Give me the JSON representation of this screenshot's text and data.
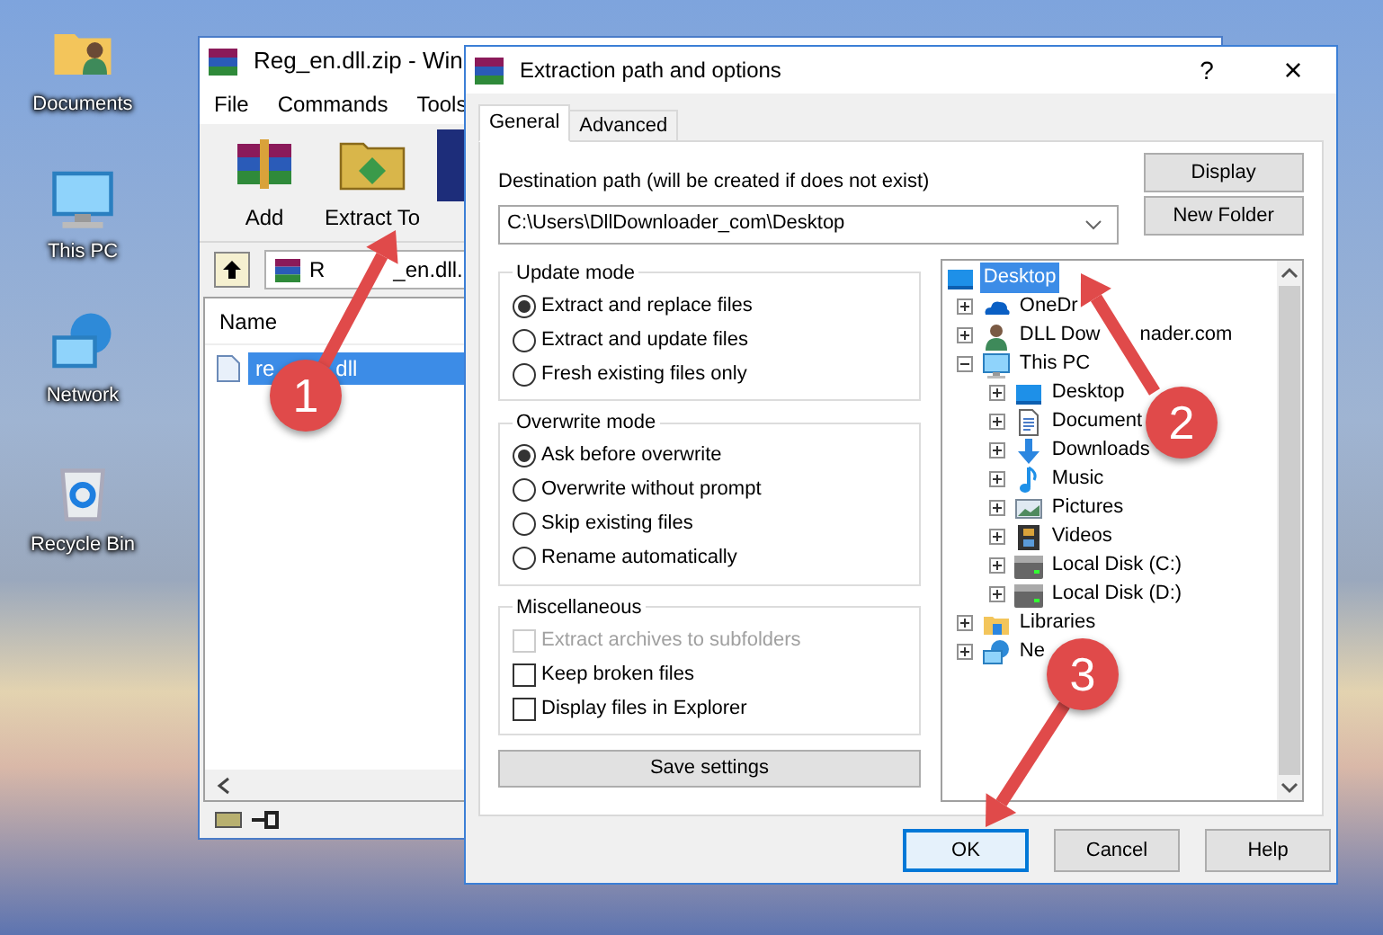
{
  "desktop_icons": [
    {
      "kind": "documents",
      "label": "Documents"
    },
    {
      "kind": "computer",
      "label": "This PC"
    },
    {
      "kind": "network",
      "label": "Network"
    },
    {
      "kind": "recycle",
      "label": "Recycle Bin"
    }
  ],
  "archiver": {
    "title": "Reg_en.dll.zip - Win",
    "menu": [
      "File",
      "Commands",
      "Tools"
    ],
    "toolbar": [
      {
        "kind": "add",
        "label": "Add"
      },
      {
        "kind": "extract",
        "label": "Extract To"
      }
    ],
    "address": {
      "text": "R",
      "text_after": "_en.dll."
    },
    "columns": [
      "Name"
    ],
    "files": [
      {
        "name": "re",
        "name_after": "dll",
        "selected": true
      }
    ]
  },
  "dialog": {
    "title": "Extraction path and options",
    "help": "?",
    "close": "×",
    "tabs": [
      {
        "label": "General",
        "selected": true
      },
      {
        "label": "Advanced",
        "selected": false
      }
    ],
    "destination": {
      "label": "Destination path (will be created if does not exist)",
      "value": "C:\\Users\\DllDownloader_com\\Desktop"
    },
    "side_buttons": [
      "Display",
      "New Folder"
    ],
    "groups": [
      {
        "title": "Update mode",
        "options": [
          {
            "kind": "radio",
            "label": "Extract and replace files",
            "checked": true
          },
          {
            "kind": "radio",
            "label": "Extract and update files",
            "checked": false
          },
          {
            "kind": "radio",
            "label": "Fresh existing files only",
            "checked": false
          }
        ]
      },
      {
        "title": "Overwrite mode",
        "options": [
          {
            "kind": "radio",
            "label": "Ask before overwrite",
            "checked": true
          },
          {
            "kind": "radio",
            "label": "Overwrite without prompt",
            "checked": false
          },
          {
            "kind": "radio",
            "label": "Skip existing files",
            "checked": false
          },
          {
            "kind": "radio",
            "label": "Rename automatically",
            "checked": false
          }
        ]
      },
      {
        "title": "Miscellaneous",
        "options": [
          {
            "kind": "checkbox",
            "label": "Extract archives to subfolders",
            "checked": false,
            "disabled": true
          },
          {
            "kind": "checkbox",
            "label": "Keep broken files",
            "checked": false,
            "disabled": false
          },
          {
            "kind": "checkbox",
            "label": "Display files in Explorer",
            "checked": false,
            "disabled": false
          }
        ]
      }
    ],
    "save_button": "Save settings",
    "tree": [
      {
        "kind": "desktop",
        "label": "Desktop",
        "selected": true,
        "children": [
          {
            "kind": "cloud",
            "label": "OneDr",
            "selected": false,
            "expanded": false
          },
          {
            "kind": "person",
            "label": "DLL Dow",
            "label_after": "nader.com",
            "selected": false,
            "expanded": false
          },
          {
            "kind": "computer",
            "label": "This PC",
            "selected": false,
            "expanded": true,
            "children": [
              {
                "kind": "desktop",
                "label": "Desktop",
                "selected": false,
                "expanded": false
              },
              {
                "kind": "document",
                "label": "Document",
                "selected": false,
                "expanded": false
              },
              {
                "kind": "download",
                "label": "Downloads",
                "selected": false,
                "expanded": false
              },
              {
                "kind": "music",
                "label": "Music",
                "selected": false,
                "expanded": false
              },
              {
                "kind": "pictures",
                "label": "Pictures",
                "selected": false,
                "expanded": false
              },
              {
                "kind": "videos",
                "label": "Videos",
                "selected": false,
                "expanded": false
              },
              {
                "kind": "disk",
                "label": "Local Disk (C:)",
                "selected": false,
                "expanded": false
              },
              {
                "kind": "disk",
                "label": "Local Disk (D:)",
                "selected": false,
                "expanded": false
              }
            ]
          },
          {
            "kind": "libraries",
            "label": "Libraries",
            "selected": false,
            "expanded": false
          },
          {
            "kind": "network",
            "label": "Ne",
            "selected": false,
            "expanded": false
          }
        ]
      }
    ],
    "buttons": [
      {
        "label": "OK",
        "default": true
      },
      {
        "label": "Cancel",
        "default": false
      },
      {
        "label": "Help",
        "default": false
      }
    ]
  },
  "annotations": [
    {
      "number": "1"
    },
    {
      "number": "2"
    },
    {
      "number": "3"
    }
  ]
}
